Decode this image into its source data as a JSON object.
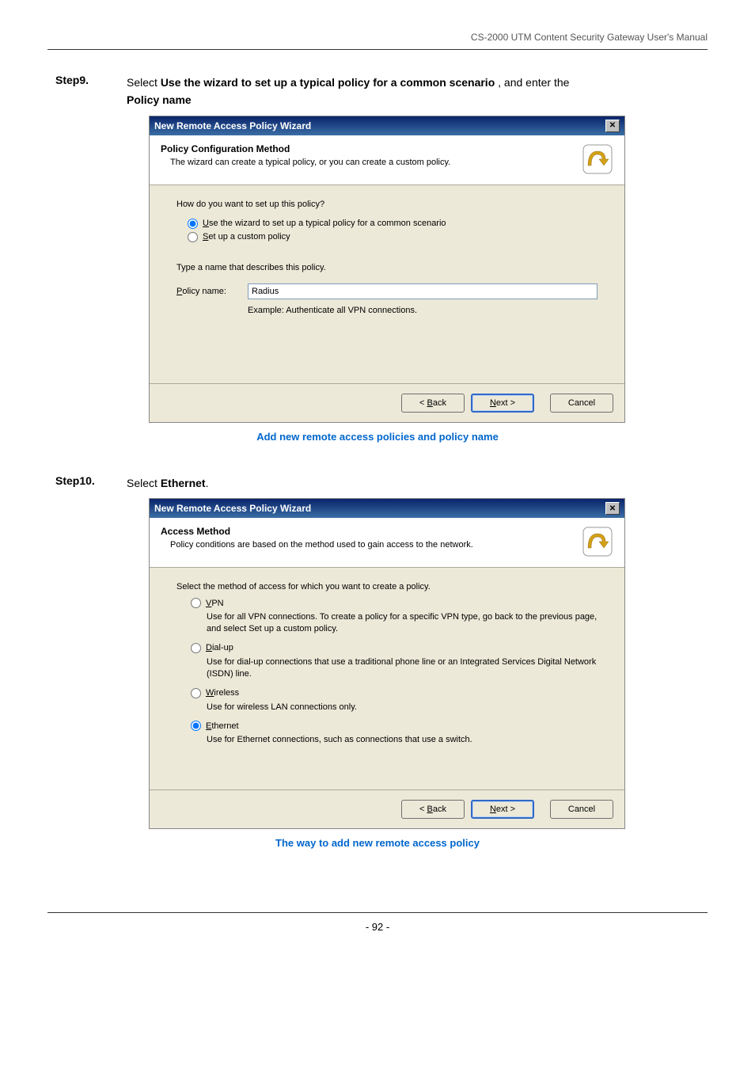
{
  "header": {
    "manual_title": "CS-2000 UTM Content Security Gateway User's Manual"
  },
  "step9": {
    "label": "Step9.",
    "text_pre": "Select ",
    "text_bold": "Use the wizard to set up a typical policy for a common scenario",
    "text_mid": " , and enter the ",
    "text_bold2": "Policy name"
  },
  "dialog1": {
    "title": "New Remote Access Policy Wizard",
    "banner_title": "Policy Configuration Method",
    "banner_sub": "The wizard can create a typical policy, or you can create a custom policy.",
    "question": "How do you want to set up this policy?",
    "opt1_u": "U",
    "opt1_rest": "se the wizard to set up a typical policy for a common scenario",
    "opt2_u": "S",
    "opt2_rest": "et up a custom policy",
    "type_label": "Type a name that describes this policy.",
    "policy_name_u": "P",
    "policy_name_rest": "olicy name:",
    "policy_name_value": "Radius",
    "example": "Example: Authenticate all VPN connections.",
    "btn_back_lt": "< ",
    "btn_back_u": "B",
    "btn_back_rest": "ack",
    "btn_next_u": "N",
    "btn_next_rest": "ext >",
    "btn_cancel": "Cancel"
  },
  "caption1": "Add new remote access policies and policy name",
  "step10": {
    "label": "Step10.",
    "text_pre": "Select ",
    "text_bold": "Ethernet",
    "text_post": "."
  },
  "dialog2": {
    "title": "New Remote Access Policy Wizard",
    "banner_title": "Access Method",
    "banner_sub": "Policy conditions are based on the method used to gain access to the network.",
    "select_text": "Select the method of access for which you want to create a policy.",
    "vpn_u": "V",
    "vpn_rest": "PN",
    "vpn_desc": "Use for all VPN connections. To create a policy for a specific VPN type, go back to the previous page, and select Set up a custom policy.",
    "dial_u": "D",
    "dial_rest": "ial-up",
    "dial_desc": "Use for dial-up connections that use a traditional phone line or an Integrated Services Digital Network (ISDN) line.",
    "wire_u": "W",
    "wire_rest": "ireless",
    "wire_desc": "Use for wireless LAN connections only.",
    "eth_u": "E",
    "eth_rest": "thernet",
    "eth_desc": "Use for Ethernet connections, such as connections that use a switch.",
    "btn_back_lt": "< ",
    "btn_back_u": "B",
    "btn_back_rest": "ack",
    "btn_next_u": "N",
    "btn_next_rest": "ext >",
    "btn_cancel": "Cancel"
  },
  "caption2": "The way to add new remote access policy",
  "footer": {
    "page_num": "- 92 -"
  }
}
